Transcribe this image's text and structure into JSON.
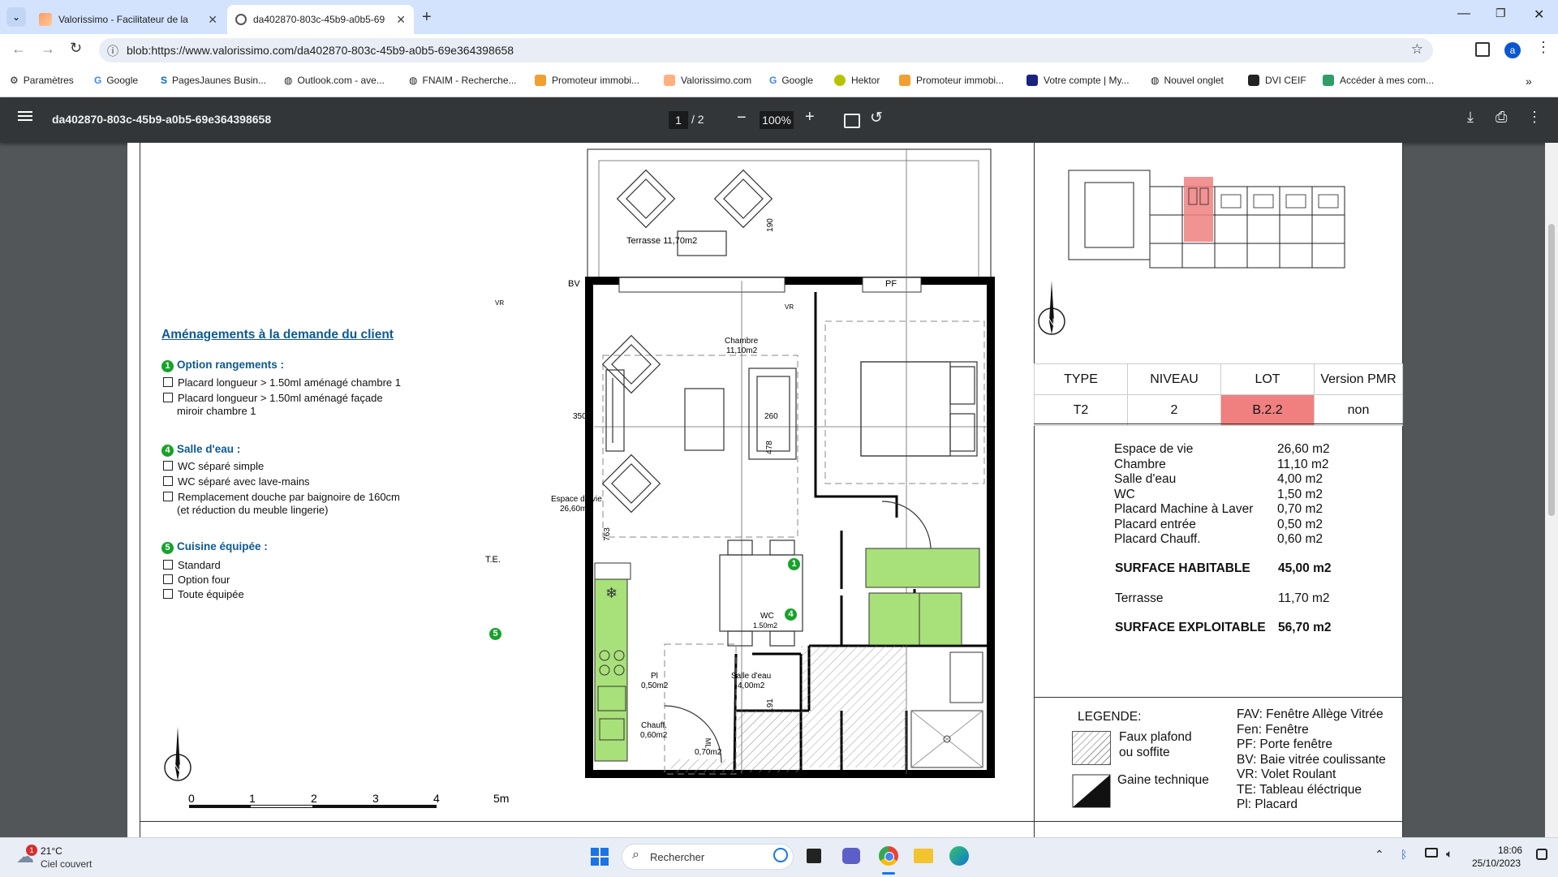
{
  "browser": {
    "tabs": [
      {
        "title": "Valorissimo - Facilitateur de la"
      },
      {
        "title": "da402870-803c-45b9-a0b5-69"
      }
    ],
    "url": "blob:https://www.valorissimo.com/da402870-803c-45b9-a0b5-69e364398658",
    "profile_initial": "a",
    "bookmarks": [
      "Paramètres",
      "Google",
      "PagesJaunes Busin...",
      "Outlook.com - ave...",
      "FNAIM - Recherche...",
      "Promoteur immobi...",
      "Valorissimo.com",
      "Google",
      "Hektor",
      "Promoteur immobi...",
      "Votre compte | My...",
      "Nouvel onglet",
      "DVI CEIF",
      "Accéder à mes com..."
    ]
  },
  "pdf_viewer": {
    "filename": "da402870-803c-45b9-a0b5-69e364398658",
    "current_page": "1",
    "total_pages": "/ 2",
    "zoom": "100%"
  },
  "plan": {
    "left_title": "Aménagements à la demande du client",
    "sections": [
      {
        "num": "1",
        "title": "Option rangements :",
        "options": [
          "Placard longueur > 1.50ml aménagé chambre 1",
          "Placard longueur > 1.50ml aménagé façade",
          "miroir chambre 1"
        ]
      },
      {
        "num": "4",
        "title": "Salle d'eau :",
        "options": [
          "WC séparé simple",
          "WC séparé avec lave-mains",
          "Remplacement douche par baignoire de 160cm",
          "(et réduction du meuble lingerie)"
        ]
      },
      {
        "num": "5",
        "title": "Cuisine équipée :",
        "options": [
          "Standard",
          "Option four",
          "Toute équipée"
        ]
      }
    ],
    "room_labels": {
      "terrasse": "Terrasse 11,70m2",
      "bv": "BV",
      "pf": "PF",
      "vr1": "VR",
      "vr2": "VR",
      "chambre": "Chambre",
      "chambre_area": "11,10m2",
      "espace": "Espace de vie",
      "espace_area": "26,60m2",
      "te": "T.E.",
      "wc": "WC",
      "wc_area": "1.50m2",
      "pl": "Pl",
      "pl_area": "0,50m2",
      "sde": "Salle d'eau",
      "sde_area": "4,00m2",
      "chauff": "Chauff.",
      "chauff_area": "0,60m2",
      "ml": "ML",
      "ml_area": "0,70m2"
    },
    "dimensions": {
      "d190": "190",
      "d350": "350",
      "d260": "260",
      "d478": "478",
      "d763": "763",
      "d191": "191"
    },
    "option_markers": [
      "1",
      "4",
      "5"
    ],
    "scale_labels": [
      "0",
      "1",
      "2",
      "3",
      "4",
      "5m"
    ],
    "table": {
      "headers": [
        "TYPE",
        "NIVEAU",
        "LOT",
        "Version PMR"
      ],
      "values": [
        "T2",
        "2",
        "B.2.2",
        "non"
      ],
      "lot_color": "#f08080"
    },
    "surfaces": [
      {
        "label": "Espace de vie",
        "value": "26,60 m2"
      },
      {
        "label": "Chambre",
        "value": "11,10 m2"
      },
      {
        "label": "Salle d'eau",
        "value": "4,00 m2"
      },
      {
        "label": "WC",
        "value": "1,50 m2"
      },
      {
        "label": "Placard Machine à Laver",
        "value": "0,70 m2"
      },
      {
        "label": "Placard entrée",
        "value": "0,50 m2"
      },
      {
        "label": "Placard Chauff.",
        "value": "0,60 m2"
      }
    ],
    "surface_habitable": {
      "label": "SURFACE HABITABLE",
      "value": "45,00 m2"
    },
    "terrasse": {
      "label": "Terrasse",
      "value": "11,70 m2"
    },
    "surface_exploitable": {
      "label": "SURFACE EXPLOITABLE",
      "value": "56,70 m2"
    },
    "legend": {
      "title": "LEGENDE:",
      "hatch_line1": "Faux plafond",
      "hatch_line2": "ou soffite",
      "gaine": "Gaine technique",
      "abbrev": [
        "FAV: Fenêtre Allège Vitrée",
        "Fen: Fenêtre",
        "PF: Porte fenêtre",
        "BV: Baie vitrée coulissante",
        "VR: Volet Roulant",
        "TE: Tableau éléctrique",
        "Pl: Placard"
      ]
    },
    "green_color": "#a8e07a"
  },
  "taskbar": {
    "weather_temp": "21°C",
    "weather_desc": "Ciel couvert",
    "weather_badge": "1",
    "search_placeholder": "Rechercher",
    "time": "18:06",
    "date": "25/10/2023"
  }
}
